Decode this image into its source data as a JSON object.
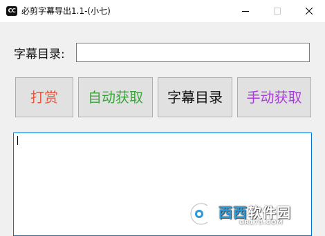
{
  "window": {
    "icon_text": "CC",
    "title": "必剪字幕导出1.1-(小七)",
    "minimize_label": "minimize",
    "maximize_label": "maximize",
    "close_label": "close"
  },
  "form": {
    "path_label": "字幕目录:",
    "path_value": ""
  },
  "buttons": [
    {
      "label": "打赏",
      "color": "#e8553a"
    },
    {
      "label": "自动获取",
      "color": "#3aa43a"
    },
    {
      "label": "字幕目录",
      "color": "#111111"
    },
    {
      "label": "手动获取",
      "color": "#a63fd6"
    }
  ],
  "output": {
    "text": ""
  },
  "watermark": {
    "site_name_a": "西西",
    "site_name_b": "软件园",
    "url": "CR173.COM"
  }
}
